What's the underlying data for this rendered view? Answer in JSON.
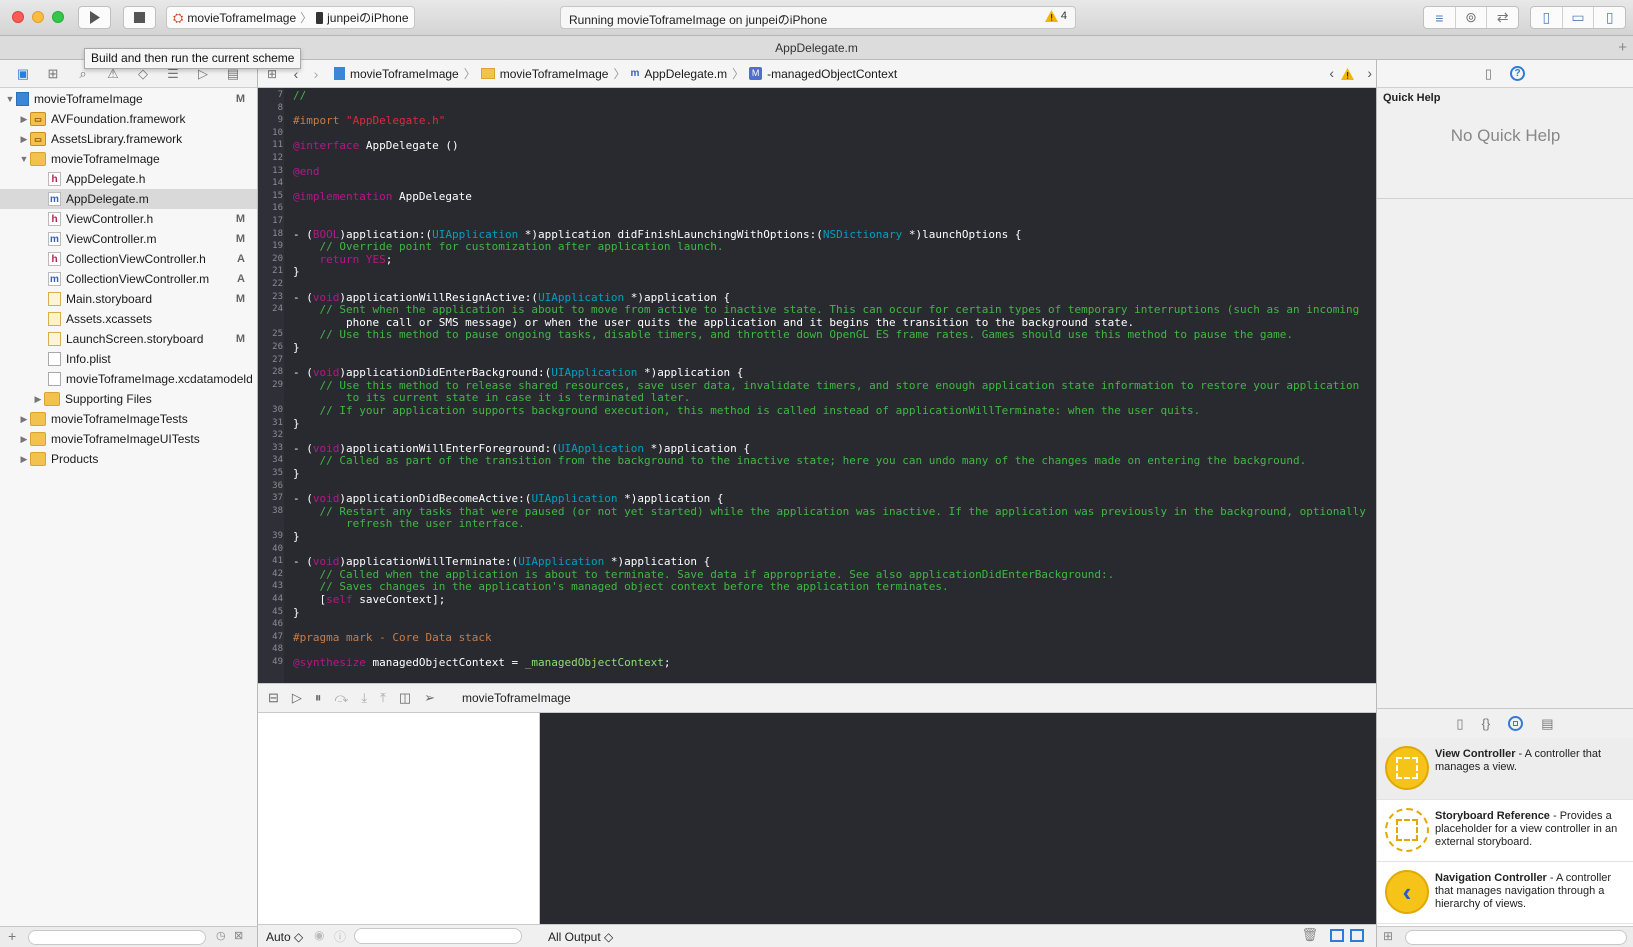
{
  "toolbar": {
    "scheme_name": "movieToframeImage",
    "device_name": "junpeiのiPhone",
    "activity_text": "Running movieToframeImage on junpeiのiPhone",
    "warning_count": "4",
    "tooltip": "Build and then run the current scheme"
  },
  "tab": {
    "title": "AppDelegate.m"
  },
  "navigator": {
    "rows": [
      {
        "label": "movieToframeImage",
        "badge": "M"
      },
      {
        "label": "AVFoundation.framework",
        "badge": ""
      },
      {
        "label": "AssetsLibrary.framework",
        "badge": ""
      },
      {
        "label": "movieToframeImage",
        "badge": ""
      },
      {
        "label": "AppDelegate.h",
        "badge": ""
      },
      {
        "label": "AppDelegate.m",
        "badge": ""
      },
      {
        "label": "ViewController.h",
        "badge": "M"
      },
      {
        "label": "ViewController.m",
        "badge": "M"
      },
      {
        "label": "CollectionViewController.h",
        "badge": "A"
      },
      {
        "label": "CollectionViewController.m",
        "badge": "A"
      },
      {
        "label": "Main.storyboard",
        "badge": "M"
      },
      {
        "label": "Assets.xcassets",
        "badge": ""
      },
      {
        "label": "LaunchScreen.storyboard",
        "badge": "M"
      },
      {
        "label": "Info.plist",
        "badge": ""
      },
      {
        "label": "movieToframeImage.xcdatamodeld",
        "badge": ""
      },
      {
        "label": "Supporting Files",
        "badge": ""
      },
      {
        "label": "movieToframeImageTests",
        "badge": ""
      },
      {
        "label": "movieToframeImageUITests",
        "badge": ""
      },
      {
        "label": "Products",
        "badge": ""
      }
    ]
  },
  "jumpbar": {
    "items": [
      "movieToframeImage",
      "movieToframeImage",
      "AppDelegate.m",
      "-managedObjectContext"
    ]
  },
  "editor": {
    "lines": [
      {
        "n": "7",
        "t": "//"
      },
      {
        "n": "8",
        "t": ""
      },
      {
        "n": "9",
        "t": "#import \"AppDelegate.h\""
      },
      {
        "n": "10",
        "t": ""
      },
      {
        "n": "11",
        "t": "@interface AppDelegate ()"
      },
      {
        "n": "12",
        "t": ""
      },
      {
        "n": "13",
        "t": "@end"
      },
      {
        "n": "14",
        "t": ""
      },
      {
        "n": "15",
        "t": "@implementation AppDelegate"
      },
      {
        "n": "16",
        "t": ""
      },
      {
        "n": "17",
        "t": ""
      },
      {
        "n": "18",
        "t": "- (BOOL)application:(UIApplication *)application didFinishLaunchingWithOptions:(NSDictionary *)launchOptions {"
      },
      {
        "n": "19",
        "t": "    // Override point for customization after application launch."
      },
      {
        "n": "20",
        "t": "    return YES;"
      },
      {
        "n": "21",
        "t": "}"
      },
      {
        "n": "22",
        "t": ""
      },
      {
        "n": "23",
        "t": "- (void)applicationWillResignActive:(UIApplication *)application {"
      },
      {
        "n": "24",
        "t": "    // Sent when the application is about to move from active to inactive state. This can occur for certain types of temporary interruptions (such as an incoming"
      },
      {
        "n": "",
        "t": "        phone call or SMS message) or when the user quits the application and it begins the transition to the background state."
      },
      {
        "n": "25",
        "t": "    // Use this method to pause ongoing tasks, disable timers, and throttle down OpenGL ES frame rates. Games should use this method to pause the game."
      },
      {
        "n": "26",
        "t": "}"
      },
      {
        "n": "27",
        "t": ""
      },
      {
        "n": "28",
        "t": "- (void)applicationDidEnterBackground:(UIApplication *)application {"
      },
      {
        "n": "29",
        "t": "    // Use this method to release shared resources, save user data, invalidate timers, and store enough application state information to restore your application"
      },
      {
        "n": "",
        "t": "        to its current state in case it is terminated later."
      },
      {
        "n": "30",
        "t": "    // If your application supports background execution, this method is called instead of applicationWillTerminate: when the user quits."
      },
      {
        "n": "31",
        "t": "}"
      },
      {
        "n": "32",
        "t": ""
      },
      {
        "n": "33",
        "t": "- (void)applicationWillEnterForeground:(UIApplication *)application {"
      },
      {
        "n": "34",
        "t": "    // Called as part of the transition from the background to the inactive state; here you can undo many of the changes made on entering the background."
      },
      {
        "n": "35",
        "t": "}"
      },
      {
        "n": "36",
        "t": ""
      },
      {
        "n": "37",
        "t": "- (void)applicationDidBecomeActive:(UIApplication *)application {"
      },
      {
        "n": "38",
        "t": "    // Restart any tasks that were paused (or not yet started) while the application was inactive. If the application was previously in the background, optionally"
      },
      {
        "n": "",
        "t": "        refresh the user interface."
      },
      {
        "n": "39",
        "t": "}"
      },
      {
        "n": "40",
        "t": ""
      },
      {
        "n": "41",
        "t": "- (void)applicationWillTerminate:(UIApplication *)application {"
      },
      {
        "n": "42",
        "t": "    // Called when the application is about to terminate. Save data if appropriate. See also applicationDidEnterBackground:."
      },
      {
        "n": "43",
        "t": "    // Saves changes in the application's managed object context before the application terminates."
      },
      {
        "n": "44",
        "t": "    [self saveContext];"
      },
      {
        "n": "45",
        "t": "}"
      },
      {
        "n": "46",
        "t": ""
      },
      {
        "n": "47",
        "t": "#pragma mark - Core Data stack"
      },
      {
        "n": "48",
        "t": ""
      },
      {
        "n": "49",
        "t": "@synthesize managedObjectContext = _managedObjectContext;"
      }
    ]
  },
  "debug": {
    "target": "movieToframeImage",
    "auto_label": "Auto ◇",
    "output_label": "All Output ◇"
  },
  "inspector": {
    "quick_help_title": "Quick Help",
    "no_quick_help": "No Quick Help"
  },
  "library": {
    "items": [
      {
        "title": "View Controller",
        "desc": " - A controller that manages a view."
      },
      {
        "title": "Storyboard Reference",
        "desc": " - Provides a placeholder for a view controller in an external storyboard."
      },
      {
        "title": "Navigation Controller",
        "desc": " - A controller that manages navigation through a hierarchy of views."
      }
    ]
  },
  "colors": {
    "editor_bg": "#292a30",
    "comment": "#41b645",
    "keyword": "#b21889",
    "type": "#00a0be",
    "accent": "#2f7bd8"
  }
}
